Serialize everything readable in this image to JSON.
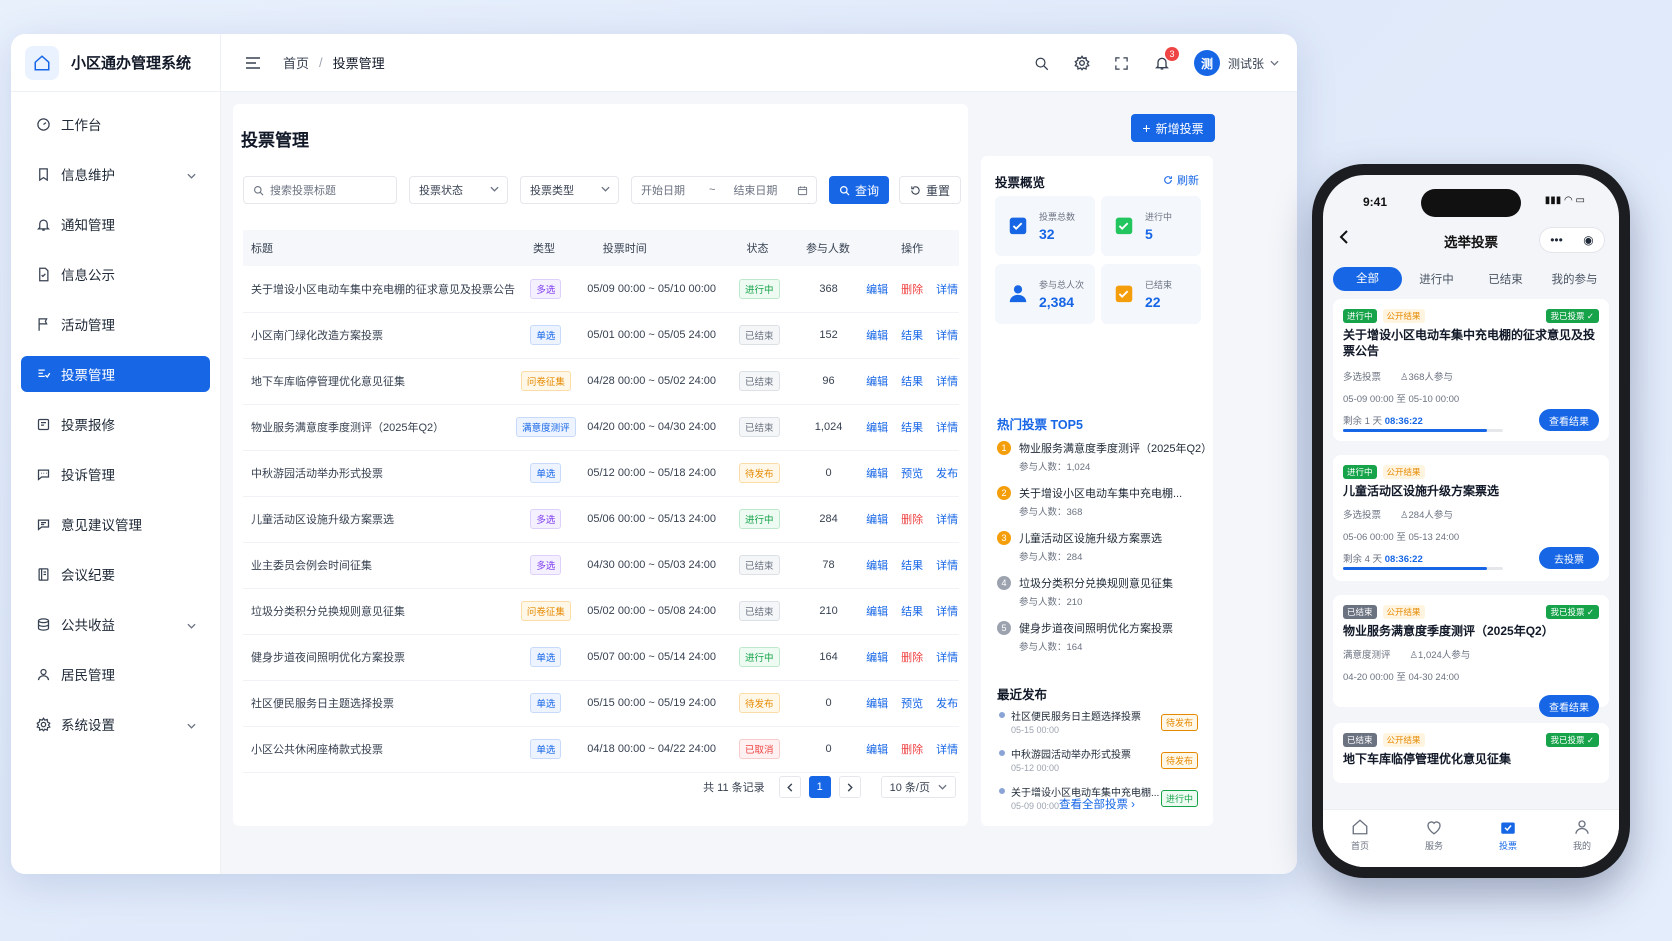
{
  "app": {
    "title": "小区通办管理系统"
  },
  "sidebar": {
    "items": [
      {
        "label": "工作台",
        "icon": "dashboard-icon"
      },
      {
        "label": "信息维护",
        "icon": "bookmark-icon",
        "expandable": true
      },
      {
        "label": "通知管理",
        "icon": "bell-icon"
      },
      {
        "label": "信息公示",
        "icon": "document-icon"
      },
      {
        "label": "活动管理",
        "icon": "flag-icon"
      },
      {
        "label": "投票管理",
        "icon": "vote-icon",
        "active": true
      },
      {
        "label": "投票报修",
        "icon": "repair-icon"
      },
      {
        "label": "投诉管理",
        "icon": "chat-icon"
      },
      {
        "label": "意见建议管理",
        "icon": "message-icon"
      },
      {
        "label": "会议纪要",
        "icon": "notebook-icon"
      },
      {
        "label": "公共收益",
        "icon": "coins-icon",
        "expandable": true
      },
      {
        "label": "居民管理",
        "icon": "user-icon"
      },
      {
        "label": "系统设置",
        "icon": "gear-icon",
        "expandable": true
      }
    ]
  },
  "topbar": {
    "breadcrumb": [
      "首页",
      "投票管理"
    ],
    "notification_count": "3",
    "user": {
      "avatar_text": "测",
      "name": "测试张"
    }
  },
  "page": {
    "title": "投票管理",
    "add_button": "新增投票",
    "filters": {
      "search_placeholder": "搜索投票标题",
      "status_label": "投票状态",
      "type_label": "投票类型",
      "start_date": "开始日期",
      "date_sep": "~",
      "end_date": "结束日期",
      "query_button": "查询",
      "reset_button": "重置"
    },
    "table": {
      "columns": [
        "标题",
        "类型",
        "投票时间",
        "状态",
        "参与人数",
        "操作"
      ],
      "rows": [
        {
          "title": "关于增设小区电动车集中充电棚的征求意见及投票公告",
          "type": "多选",
          "type_cls": "t-multi",
          "time": "05/09 00:00 ~ 05/10 00:00",
          "status": "进行中",
          "status_cls": "s-run",
          "count": "368",
          "ops": [
            "编辑",
            "删除",
            "详情"
          ]
        },
        {
          "title": "小区南门绿化改造方案投票",
          "type": "单选",
          "type_cls": "t-single",
          "time": "05/01 00:00 ~ 05/05 24:00",
          "status": "已结束",
          "status_cls": "s-end",
          "count": "152",
          "ops": [
            "编辑",
            "结果",
            "详情"
          ]
        },
        {
          "title": "地下车库临停管理优化意见征集",
          "type": "问卷征集",
          "type_cls": "t-survey",
          "time": "04/28 00:00 ~ 05/02 24:00",
          "status": "已结束",
          "status_cls": "s-end",
          "count": "96",
          "ops": [
            "编辑",
            "结果",
            "详情"
          ]
        },
        {
          "title": "物业服务满意度季度测评（2025年Q2）",
          "type": "满意度测评",
          "type_cls": "t-sat",
          "time": "04/20 00:00 ~ 04/30 24:00",
          "status": "已结束",
          "status_cls": "s-end",
          "count": "1,024",
          "ops": [
            "编辑",
            "结果",
            "详情"
          ]
        },
        {
          "title": "中秋游园活动举办形式投票",
          "type": "单选",
          "type_cls": "t-single",
          "time": "05/12 00:00 ~ 05/18 24:00",
          "status": "待发布",
          "status_cls": "s-pend",
          "count": "0",
          "ops": [
            "编辑",
            "预览",
            "发布"
          ]
        },
        {
          "title": "儿童活动区设施升级方案票选",
          "type": "多选",
          "type_cls": "t-multi",
          "time": "05/06 00:00 ~ 05/13 24:00",
          "status": "进行中",
          "status_cls": "s-run",
          "count": "284",
          "ops": [
            "编辑",
            "删除",
            "详情"
          ]
        },
        {
          "title": "业主委员会例会时间征集",
          "type": "多选",
          "type_cls": "t-multi",
          "time": "04/30 00:00 ~ 05/03 24:00",
          "status": "已结束",
          "status_cls": "s-end",
          "count": "78",
          "ops": [
            "编辑",
            "结果",
            "详情"
          ]
        },
        {
          "title": "垃圾分类积分兑换规则意见征集",
          "type": "问卷征集",
          "type_cls": "t-survey",
          "time": "05/02 00:00 ~ 05/08 24:00",
          "status": "已结束",
          "status_cls": "s-end",
          "count": "210",
          "ops": [
            "编辑",
            "结果",
            "详情"
          ]
        },
        {
          "title": "健身步道夜间照明优化方案投票",
          "type": "单选",
          "type_cls": "t-single",
          "time": "05/07 00:00 ~ 05/14 24:00",
          "status": "进行中",
          "status_cls": "s-run",
          "count": "164",
          "ops": [
            "编辑",
            "删除",
            "详情"
          ]
        },
        {
          "title": "社区便民服务日主题选择投票",
          "type": "单选",
          "type_cls": "t-single",
          "time": "05/15 00:00 ~ 05/19 24:00",
          "status": "待发布",
          "status_cls": "s-pend",
          "count": "0",
          "ops": [
            "编辑",
            "预览",
            "发布"
          ]
        },
        {
          "title": "小区公共休闲座椅款式投票",
          "type": "单选",
          "type_cls": "t-single",
          "time": "04/18 00:00 ~ 04/22 24:00",
          "status": "已取消",
          "status_cls": "s-cancel",
          "count": "0",
          "ops": [
            "编辑",
            "删除",
            "详情"
          ]
        }
      ]
    },
    "pagination": {
      "total": "共 11 条记录",
      "current": "1",
      "page_size": "10 条/页"
    }
  },
  "overview": {
    "title": "投票概览",
    "refresh": "刷新",
    "stats": [
      {
        "label": "投票总数",
        "value": "32"
      },
      {
        "label": "进行中",
        "value": "5"
      },
      {
        "label": "参与总人次",
        "value": "2,384"
      },
      {
        "label": "已结束",
        "value": "22"
      }
    ],
    "hot_title": "热门投票 TOP5",
    "hot": [
      {
        "rank": "1",
        "name": "物业服务满意度季度测评（2025年Q2）",
        "sub": "参与人数：1,024",
        "color": "#f59e0b"
      },
      {
        "rank": "2",
        "name": "关于增设小区电动车集中充电棚...",
        "sub": "参与人数：368",
        "color": "#f59e0b"
      },
      {
        "rank": "3",
        "name": "儿童活动区设施升级方案票选",
        "sub": "参与人数：284",
        "color": "#f59e0b"
      },
      {
        "rank": "4",
        "name": "垃圾分类积分兑换规则意见征集",
        "sub": "参与人数：210",
        "color": "#9ca3af"
      },
      {
        "rank": "5",
        "name": "健身步道夜间照明优化方案投票",
        "sub": "参与人数：164",
        "color": "#9ca3af"
      }
    ],
    "recent_title": "最近发布",
    "recent": [
      {
        "name": "社区便民服务日主题选择投票",
        "time": "05-15 00:00",
        "tag": "待发布",
        "cls": "s-pend"
      },
      {
        "name": "中秋游园活动举办形式投票",
        "time": "05-12 00:00",
        "tag": "待发布",
        "cls": "s-pend"
      },
      {
        "name": "关于增设小区电动车集中充电棚...",
        "time": "05-09 00:00",
        "tag": "进行中",
        "cls": "s-run"
      }
    ],
    "view_all": "查看全部投票 ›"
  },
  "mobile": {
    "time": "9:41",
    "title": "选举投票",
    "tabs": [
      "全部",
      "进行中",
      "已结束",
      "我的参与"
    ],
    "cards": [
      {
        "state": "进行中",
        "state_cls": "p-run",
        "pub": "公开结果",
        "voted": "我已投票 ✓",
        "title": "关于增设小区电动车集中充电棚的征求意见及投票公告",
        "meta": "多选投票　　♙368人参与",
        "range": "05-09 00:00 至 05-10 00:00",
        "remain_prefix": "剩余 1 天 ",
        "remain_time": "08:36:22",
        "progress": 0.9,
        "button": "查看结果"
      },
      {
        "state": "进行中",
        "state_cls": "p-run",
        "pub": "公开结果",
        "voted": "",
        "title": "儿童活动区设施升级方案票选",
        "meta": "多选投票　　♙284人参与",
        "range": "05-06 00:00 至 05-13 24:00",
        "remain_prefix": "剩余 4 天 ",
        "remain_time": "08:36:22",
        "progress": 0.9,
        "button": "去投票"
      },
      {
        "state": "已结束",
        "state_cls": "p-end",
        "pub": "公开结果",
        "voted": "我已投票 ✓",
        "title": "物业服务满意度季度测评（2025年Q2）",
        "meta": "满意度测评　　♙1,024人参与",
        "range": "04-20 00:00 至 04-30 24:00",
        "button": "查看结果"
      },
      {
        "state": "已结束",
        "state_cls": "p-end",
        "pub": "公开结果",
        "voted": "我已投票 ✓",
        "title": "地下车库临停管理优化意见征集"
      }
    ],
    "nav": [
      "首页",
      "服务",
      "投票",
      "我的"
    ]
  }
}
